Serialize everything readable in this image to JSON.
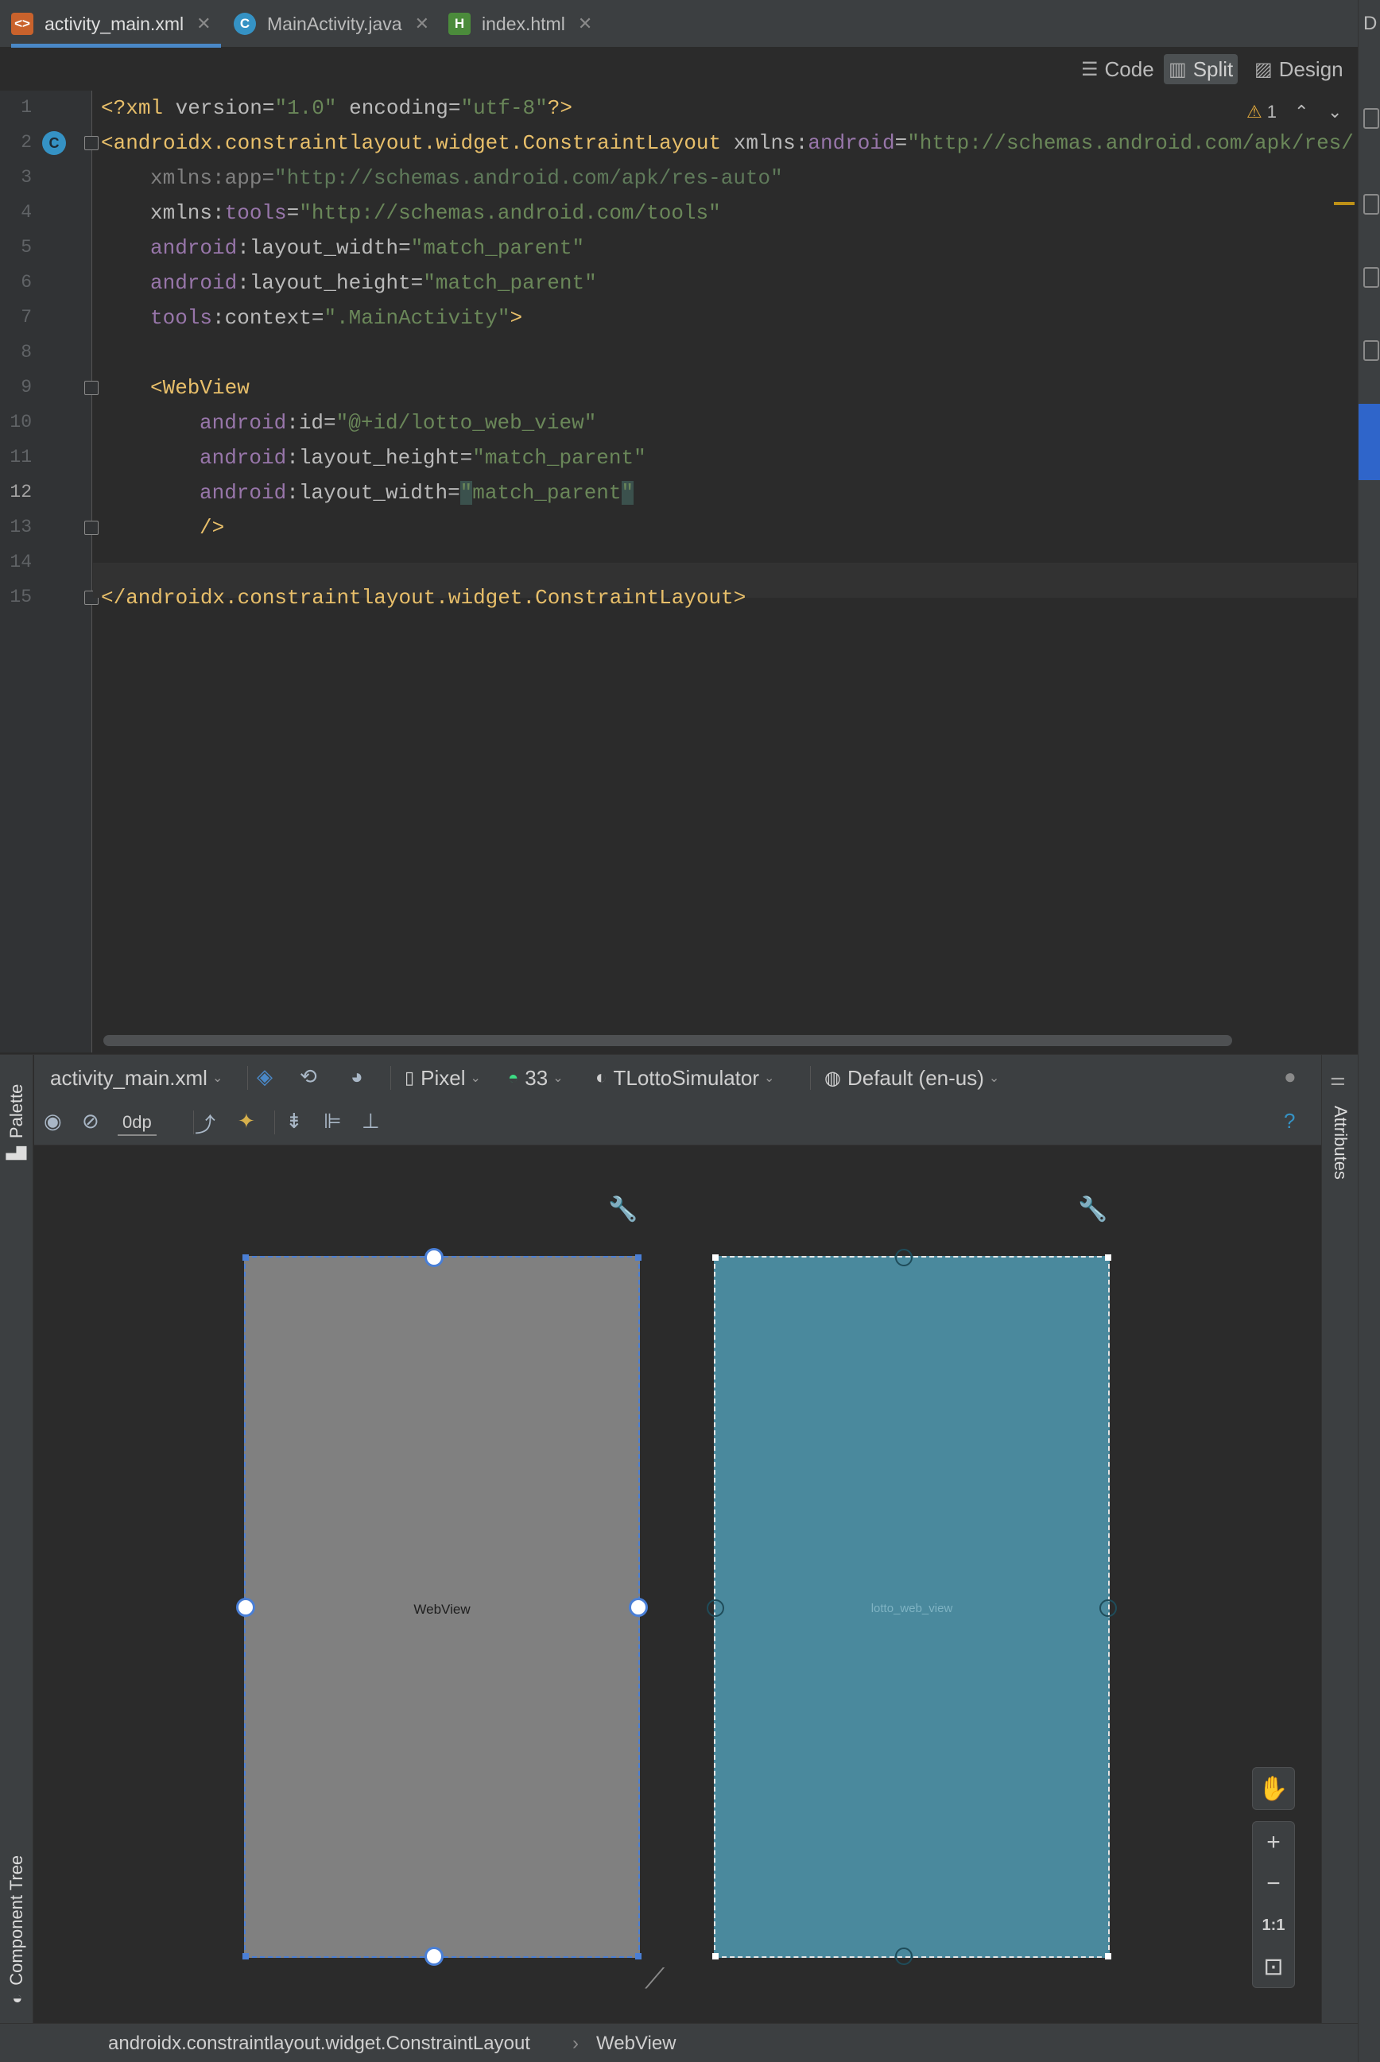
{
  "tabs": [
    {
      "label": "activity_main.xml",
      "icon": "xml-file-icon",
      "active": true
    },
    {
      "label": "MainActivity.java",
      "icon": "java-class-icon",
      "active": false
    },
    {
      "label": "index.html",
      "icon": "html-file-icon",
      "active": false
    }
  ],
  "right_strip_label": "D",
  "view_modes": {
    "code": "Code",
    "split": "Split",
    "design": "Design",
    "active": "Split"
  },
  "editor": {
    "warning_count": "1",
    "current_line": 12,
    "lines": [
      "1",
      "2",
      "3",
      "4",
      "5",
      "6",
      "7",
      "8",
      "9",
      "10",
      "11",
      "12",
      "13",
      "14",
      "15"
    ],
    "code": {
      "l1": {
        "open": "<?",
        "xml": "xml",
        "a1": " version",
        "eq1": "=",
        "v1": "\"1.0\"",
        "a2": " encoding",
        "eq2": "=",
        "v2": "\"utf-8\"",
        "close": "?>"
      },
      "l2": {
        "tag": "<androidx.constraintlayout.widget.ConstraintLayout",
        "attr": " xmlns:",
        "ns": "android",
        "eq": "=",
        "val": "\"http://schemas.android.com/apk/res/"
      },
      "l3": {
        "attr": "xmlns:app",
        "eq": "=",
        "val": "\"http://schemas.android.com/apk/res-auto\""
      },
      "l4": {
        "attr": "xmlns:",
        "ns": "tools",
        "eq": "=",
        "val": "\"http://schemas.android.com/tools\""
      },
      "l5": {
        "ns": "android",
        "attr": ":layout_width",
        "eq": "=",
        "val": "\"match_parent\""
      },
      "l6": {
        "ns": "android",
        "attr": ":layout_height",
        "eq": "=",
        "val": "\"match_parent\""
      },
      "l7": {
        "ns": "tools",
        "attr": ":context",
        "eq": "=",
        "val": "\".MainActivity\"",
        "close": ">"
      },
      "l9": {
        "tag": "<WebView"
      },
      "l10": {
        "ns": "android",
        "attr": ":id",
        "eq": "=",
        "val": "\"@+id/lotto_web_view\""
      },
      "l11": {
        "ns": "android",
        "attr": ":layout_height",
        "eq": "=",
        "val": "\"match_parent\""
      },
      "l12": {
        "ns": "android",
        "attr": ":layout_width",
        "eq": "=",
        "q1": "\"",
        "val": "match_parent",
        "q2": "\""
      },
      "l13": {
        "tag": "/>"
      },
      "l15": {
        "tag": "</androidx.constraintlayout.widget.ConstraintLayout>"
      }
    }
  },
  "design": {
    "palette_label": "Palette",
    "component_tree_label": "Component Tree",
    "attributes_label": "Attributes",
    "toolbar1": {
      "file": "activity_main.xml",
      "device": "Pixel",
      "api": "33",
      "theme": "TLottoSimulator",
      "locale": "Default (en-us)"
    },
    "toolbar2": {
      "margin": "0dp"
    },
    "blueprint_left_label": "WebView",
    "blueprint_right_label": "lotto_web_view",
    "zoom": {
      "in": "+",
      "out": "−",
      "actual": "1:1"
    },
    "breadcrumb": [
      "androidx.constraintlayout.widget.ConstraintLayout",
      "WebView"
    ],
    "colors": {
      "accent": "#4a88c7",
      "design_surface": "#808080",
      "blueprint_surface": "#4a899d"
    }
  }
}
